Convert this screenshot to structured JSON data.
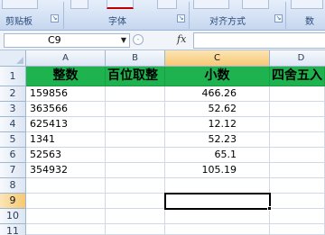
{
  "ribbon": {
    "groups": [
      {
        "label": "剪贴板"
      },
      {
        "label": "字体"
      },
      {
        "label": "对齐方式"
      },
      {
        "label": "数"
      }
    ],
    "accent_red": "#c00000"
  },
  "formula_bar": {
    "name_box": "C9",
    "fx_label": "fx",
    "formula_value": ""
  },
  "sheet": {
    "columns": [
      "A",
      "B",
      "C",
      "D"
    ],
    "rows": [
      "1",
      "2",
      "3",
      "4",
      "5",
      "6",
      "7",
      "8",
      "9",
      "10",
      "11"
    ],
    "active_cell": "C9",
    "header_fill": "#1fb350",
    "headers": {
      "A": "整数",
      "B": "百位取整",
      "C": "小数",
      "D": "四舍五入"
    },
    "col_a": [
      "159856",
      "363566",
      "625413",
      "1341",
      "52563",
      "354932"
    ],
    "col_c": [
      "466.26",
      "52.62",
      "12.12",
      "52.23",
      "65.1",
      "105.19"
    ]
  }
}
